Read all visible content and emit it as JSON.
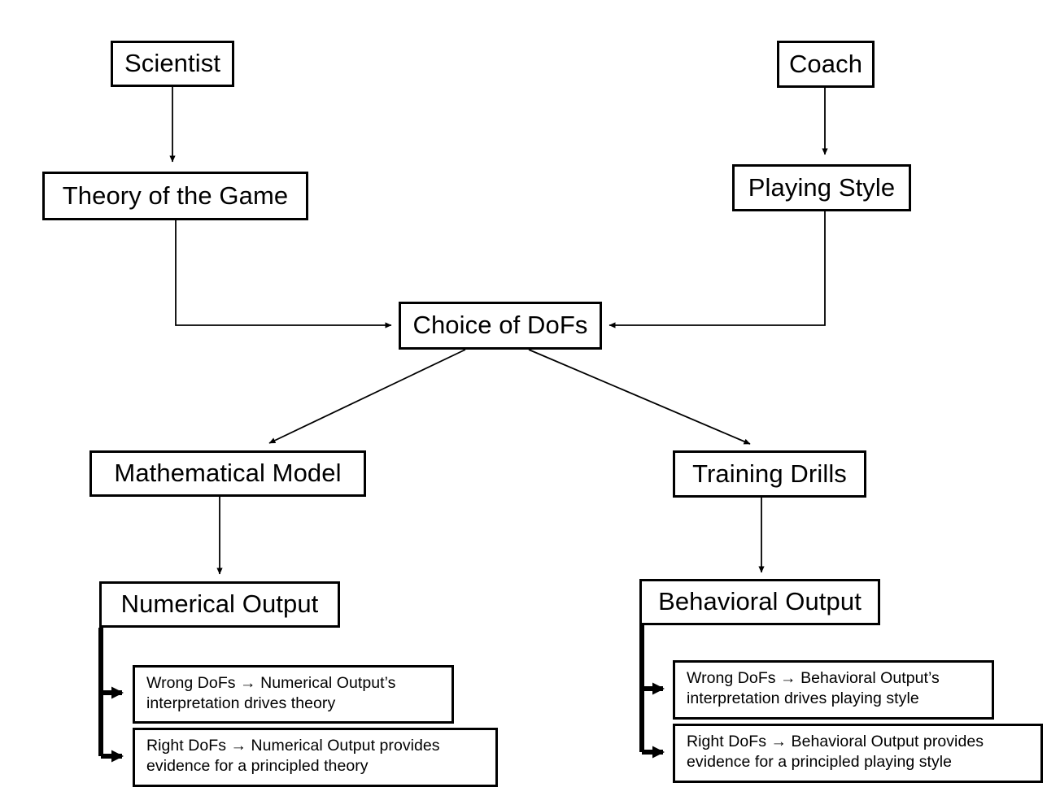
{
  "diagram": {
    "title": "Choice of DoFs flow diagram",
    "background_color": "#ffffff",
    "line_color": "#000000",
    "nodes": {
      "scientist": {
        "label": "Scientist"
      },
      "coach": {
        "label": "Coach"
      },
      "theory_of_the_game": {
        "label": "Theory of the Game"
      },
      "playing_style": {
        "label": "Playing Style"
      },
      "choice_of_dofs": {
        "label": "Choice of DoFs"
      },
      "mathematical_model": {
        "label": "Mathematical Model"
      },
      "training_drills": {
        "label": "Training Drills"
      },
      "numerical_output": {
        "label": "Numerical Output"
      },
      "behavioral_output": {
        "label": "Behavioral Output"
      },
      "numerical_wrong": {
        "label": "Wrong DoFs → Numerical Output’s interpretation drives theory"
      },
      "numerical_right": {
        "label": "Right DoFs → Numerical Output provides evidence for a principled theory"
      },
      "behavioral_wrong": {
        "label": "Wrong DoFs → Behavioral Output’s interpretation drives playing style"
      },
      "behavioral_right": {
        "label": "Right DoFs → Behavioral Output provides evidence for a principled playing style"
      }
    },
    "edges": [
      {
        "from": "scientist",
        "to": "theory_of_the_game",
        "style": "straight-down"
      },
      {
        "from": "coach",
        "to": "playing_style",
        "style": "straight-down"
      },
      {
        "from": "theory_of_the_game",
        "to": "choice_of_dofs",
        "style": "elbow-right"
      },
      {
        "from": "playing_style",
        "to": "choice_of_dofs",
        "style": "elbow-left"
      },
      {
        "from": "choice_of_dofs",
        "to": "mathematical_model",
        "style": "diagonal-down-left"
      },
      {
        "from": "choice_of_dofs",
        "to": "training_drills",
        "style": "diagonal-down-right"
      },
      {
        "from": "mathematical_model",
        "to": "numerical_output",
        "style": "straight-down"
      },
      {
        "from": "training_drills",
        "to": "behavioral_output",
        "style": "straight-down"
      },
      {
        "from": "numerical_output",
        "to": "numerical_wrong",
        "style": "thick-elbow"
      },
      {
        "from": "numerical_output",
        "to": "numerical_right",
        "style": "thick-elbow"
      },
      {
        "from": "behavioral_output",
        "to": "behavioral_wrong",
        "style": "thick-elbow"
      },
      {
        "from": "behavioral_output",
        "to": "behavioral_right",
        "style": "thick-elbow"
      }
    ]
  }
}
